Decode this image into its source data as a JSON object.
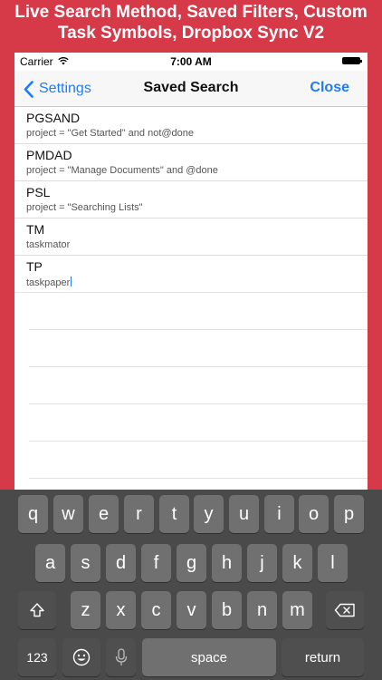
{
  "promo": {
    "line1": "Live Search Method, Saved Filters, Custom",
    "line2": "Task Symbols, Dropbox Sync V2"
  },
  "status_bar": {
    "carrier": "Carrier",
    "time": "7:00 AM"
  },
  "nav": {
    "back_label": "Settings",
    "title": "Saved Search",
    "close_label": "Close"
  },
  "saved_searches": [
    {
      "name": "PGSAND",
      "query": "project = \"Get Started\" and not@done"
    },
    {
      "name": "PMDAD",
      "query": "project = \"Manage Documents\" and @done"
    },
    {
      "name": "PSL",
      "query": "project = \"Searching Lists\""
    },
    {
      "name": "TM",
      "query": "taskmator"
    },
    {
      "name": "TP",
      "query": "taskpaper"
    }
  ],
  "keyboard": {
    "row1": [
      "q",
      "w",
      "e",
      "r",
      "t",
      "y",
      "u",
      "i",
      "o",
      "p"
    ],
    "row2": [
      "a",
      "s",
      "d",
      "f",
      "g",
      "h",
      "j",
      "k",
      "l"
    ],
    "row3": [
      "z",
      "x",
      "c",
      "v",
      "b",
      "n",
      "m"
    ],
    "numbers_label": "123",
    "space_label": "space",
    "return_label": "return"
  }
}
